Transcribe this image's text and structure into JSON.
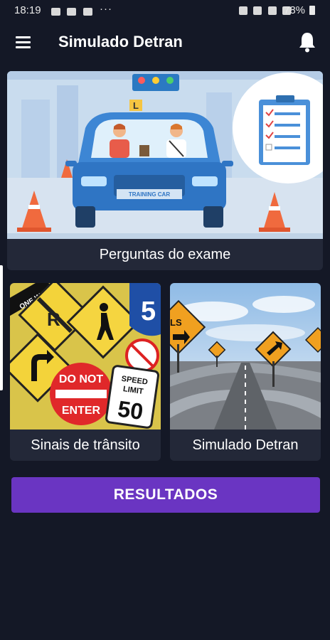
{
  "status_bar": {
    "time": "18:19",
    "dots": "···",
    "battery": "78%"
  },
  "app_bar": {
    "title": "Simulado Detran"
  },
  "cards": {
    "exam": {
      "label": "Perguntas do exame",
      "car_plate": "TRAINING CAR",
      "sign_letter": "L"
    },
    "signs": {
      "label": "Sinais de trânsito",
      "sign_r": "R",
      "sign_5": "5",
      "sign_one_way": "ONE WAY",
      "sign_do_not": "DO NOT",
      "sign_enter": "ENTER",
      "sign_speed": "SPEED",
      "sign_limit": "LIMIT",
      "sign_50": "50"
    },
    "simulado": {
      "label": "Simulado Detran",
      "sign_ls": "LS"
    }
  },
  "results_button": {
    "label": "RESULTADOS"
  },
  "colors": {
    "background": "#141826",
    "card": "#232838",
    "accent": "#6a35c2"
  }
}
